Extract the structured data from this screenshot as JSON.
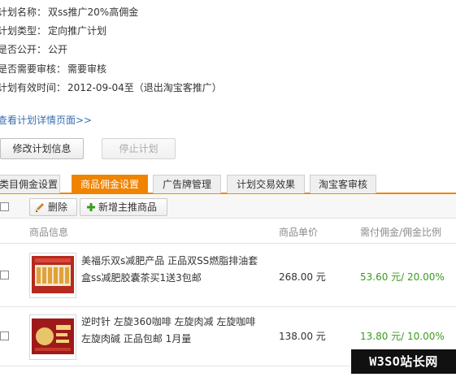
{
  "plan": {
    "name_label": "计划名称：",
    "name_value": "双ss推广20%高佣金",
    "type_label": "计划类型：",
    "type_value": "定向推广计划",
    "public_label": "是否公开：",
    "public_value": "公开",
    "review_label": "是否需要审核：",
    "review_value": "需要审核",
    "valid_label": "计划有效时间：",
    "valid_value": "2012-09-04至（退出淘宝客推广）",
    "detail_link": "查看计划详情页面>>"
  },
  "actions": {
    "edit_label": "修改计划信息",
    "stop_label": "停止计划"
  },
  "tabs": [
    {
      "label": "类目佣金设置",
      "active": false
    },
    {
      "label": "商品佣金设置",
      "active": true
    },
    {
      "label": "广告牌管理",
      "active": false
    },
    {
      "label": "计划交易效果",
      "active": false
    },
    {
      "label": "淘宝客审核",
      "active": false
    }
  ],
  "toolbar": {
    "delete_label": "删除",
    "add_label": "新增主推商品"
  },
  "table": {
    "headers": [
      "商品信息",
      "商品单价",
      "需付佣金/佣金比例"
    ],
    "rows": [
      {
        "name_line1": "美福乐双s减肥产品 正品双SS燃脂排油套",
        "name_line2": "盒ss减肥胶囊茶买1送3包邮",
        "price": "268.00 元",
        "commission": "53.60 元/  20.00%"
      },
      {
        "name_line1": "逆时针 左旋360咖啡 左旋肉减 左旋咖啡",
        "name_line2": "左旋肉碱 正品包邮 1月量",
        "price": "138.00 元",
        "commission": "13.80 元/  10.00%"
      }
    ]
  },
  "watermark": "W3SO站长网",
  "colors": {
    "accent": "#f08300",
    "link": "#3a6fb0",
    "commission": "#3c9a1e"
  },
  "icons": {
    "delete": "broom-icon",
    "add": "plus-icon"
  }
}
